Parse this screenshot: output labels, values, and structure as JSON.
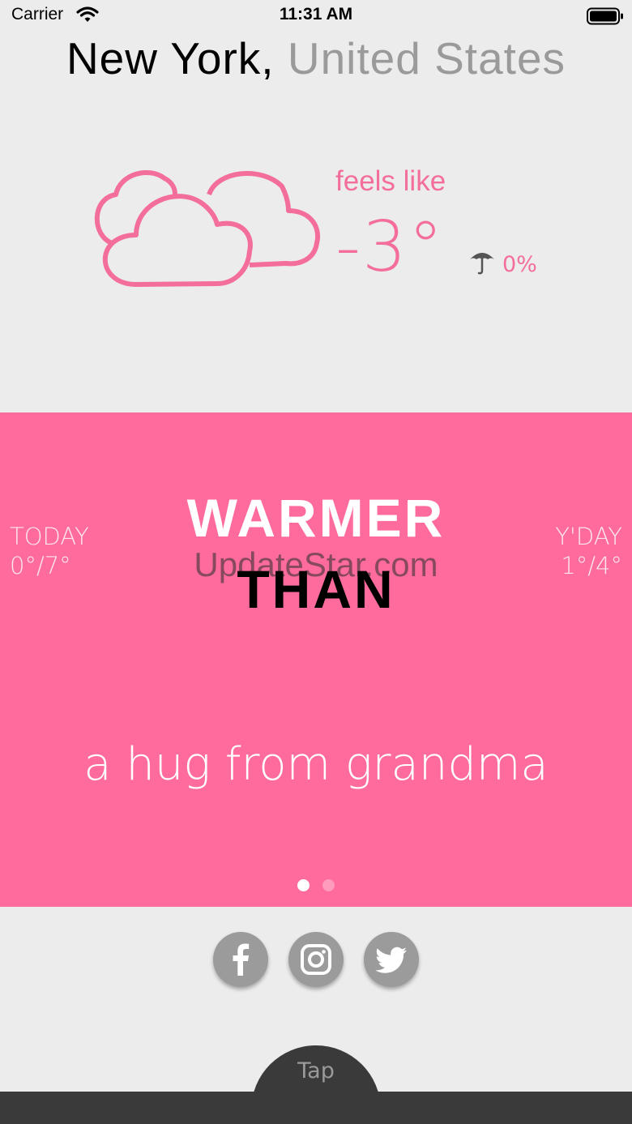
{
  "status_bar": {
    "carrier": "Carrier",
    "time": "11:31 AM",
    "wifi_icon": "wifi-icon",
    "battery_icon": "battery-icon"
  },
  "location": {
    "city": "New York,",
    "country": "United States"
  },
  "current": {
    "condition_icon": "cloudy-icon",
    "feels_like_label": "feels like",
    "temperature": "-3°",
    "precip_icon": "umbrella-icon",
    "precip": "0%"
  },
  "comparison": {
    "today_label": "TODAY",
    "today_range": "0°/7°",
    "yday_label": "Y'DAY",
    "yday_range": "1°/4°",
    "headline_1": "WARMER",
    "headline_2": "THAN",
    "watermark": "UpdateStar.com",
    "subline": "a hug from grandma",
    "page_index": 1,
    "page_count": 2
  },
  "social": [
    {
      "name": "facebook",
      "icon": "facebook-icon"
    },
    {
      "name": "instagram",
      "icon": "instagram-icon"
    },
    {
      "name": "twitter",
      "icon": "twitter-icon"
    }
  ],
  "footer": {
    "tap_label": "Tap"
  },
  "colors": {
    "accent": "#ff6b9d",
    "accent_text": "#f46e9b",
    "background": "#ececec",
    "footer": "#3a3a3a",
    "social_button": "#9b9b9b"
  }
}
